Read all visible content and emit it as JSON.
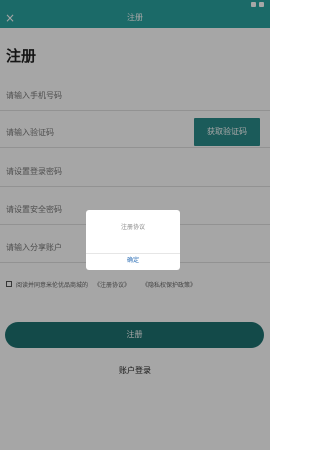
{
  "header": {
    "title": "注册",
    "back_icon": "×"
  },
  "form": {
    "heading": "注册",
    "phone_placeholder": "请输入手机号码",
    "code_placeholder": "请输入验证码",
    "code_button": "获取验证码",
    "login_password_placeholder": "请设置登录密码",
    "security_password_placeholder": "请设置安全密码",
    "share_account_placeholder": "请输入分享账户"
  },
  "agreement": {
    "text": "阅读并同意米伦优品商城的",
    "link1": "《注册协议》",
    "link2": "《隐私权保护政策》"
  },
  "actions": {
    "register": "注册",
    "login": "账户登录"
  },
  "dialog": {
    "title": "注册协议",
    "ok": "确定"
  },
  "colors": {
    "accent": "#2aa3a0",
    "button_dark": "#1e7271",
    "link": "#2d6fb6"
  }
}
